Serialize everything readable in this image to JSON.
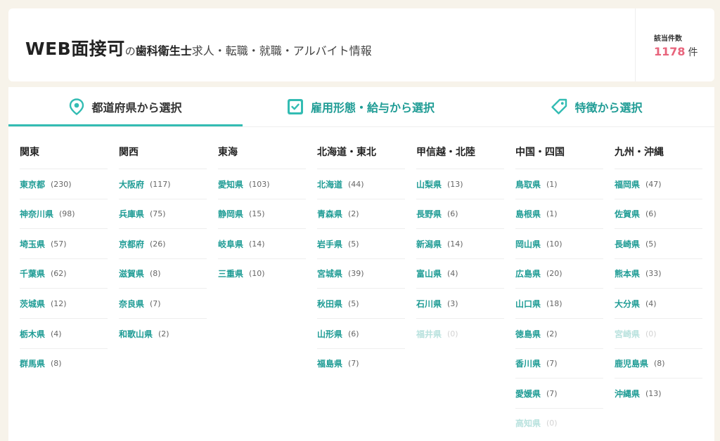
{
  "header": {
    "title_main": "WEB面接可",
    "title_no": "の",
    "title_job": "歯科衛生士",
    "title_rest": "求人・転職・就職・アルバイト情報",
    "count_label": "該当件数",
    "count_value": "1178",
    "count_unit": "件"
  },
  "tabs": [
    {
      "label": "都道府県から選択",
      "icon": "map-pin-icon",
      "active": true
    },
    {
      "label": "雇用形態・給与から選択",
      "icon": "checkbox-icon",
      "active": false
    },
    {
      "label": "特徴から選択",
      "icon": "tag-icon",
      "active": false
    }
  ],
  "colors": {
    "accent": "#33bcb3",
    "link": "#1f9c95",
    "count": "#e8647c",
    "background": "#f7f3ea"
  },
  "regions": [
    {
      "name": "関東",
      "prefs": [
        {
          "name": "東京都",
          "count": "(230)"
        },
        {
          "name": "神奈川県",
          "count": "(98)"
        },
        {
          "name": "埼玉県",
          "count": "(57)"
        },
        {
          "name": "千葉県",
          "count": "(62)"
        },
        {
          "name": "茨城県",
          "count": "(12)"
        },
        {
          "name": "栃木県",
          "count": "(4)"
        },
        {
          "name": "群馬県",
          "count": "(8)"
        }
      ]
    },
    {
      "name": "関西",
      "prefs": [
        {
          "name": "大阪府",
          "count": "(117)"
        },
        {
          "name": "兵庫県",
          "count": "(75)"
        },
        {
          "name": "京都府",
          "count": "(26)"
        },
        {
          "name": "滋賀県",
          "count": "(8)"
        },
        {
          "name": "奈良県",
          "count": "(7)"
        },
        {
          "name": "和歌山県",
          "count": "(2)"
        }
      ]
    },
    {
      "name": "東海",
      "prefs": [
        {
          "name": "愛知県",
          "count": "(103)"
        },
        {
          "name": "静岡県",
          "count": "(15)"
        },
        {
          "name": "岐阜県",
          "count": "(14)"
        },
        {
          "name": "三重県",
          "count": "(10)"
        }
      ]
    },
    {
      "name": "北海道・東北",
      "prefs": [
        {
          "name": "北海道",
          "count": "(44)"
        },
        {
          "name": "青森県",
          "count": "(2)"
        },
        {
          "name": "岩手県",
          "count": "(5)"
        },
        {
          "name": "宮城県",
          "count": "(39)"
        },
        {
          "name": "秋田県",
          "count": "(5)"
        },
        {
          "name": "山形県",
          "count": "(6)"
        },
        {
          "name": "福島県",
          "count": "(7)"
        }
      ]
    },
    {
      "name": "甲信越・北陸",
      "prefs": [
        {
          "name": "山梨県",
          "count": "(13)"
        },
        {
          "name": "長野県",
          "count": "(6)"
        },
        {
          "name": "新潟県",
          "count": "(14)"
        },
        {
          "name": "富山県",
          "count": "(4)"
        },
        {
          "name": "石川県",
          "count": "(3)"
        },
        {
          "name": "福井県",
          "count": "(0)",
          "disabled": true
        }
      ]
    },
    {
      "name": "中国・四国",
      "prefs": [
        {
          "name": "鳥取県",
          "count": "(1)"
        },
        {
          "name": "島根県",
          "count": "(1)"
        },
        {
          "name": "岡山県",
          "count": "(10)"
        },
        {
          "name": "広島県",
          "count": "(20)"
        },
        {
          "name": "山口県",
          "count": "(18)"
        },
        {
          "name": "徳島県",
          "count": "(2)"
        },
        {
          "name": "香川県",
          "count": "(7)"
        },
        {
          "name": "愛媛県",
          "count": "(7)"
        },
        {
          "name": "高知県",
          "count": "(0)",
          "disabled": true
        }
      ]
    },
    {
      "name": "九州・沖縄",
      "prefs": [
        {
          "name": "福岡県",
          "count": "(47)"
        },
        {
          "name": "佐賀県",
          "count": "(6)"
        },
        {
          "name": "長崎県",
          "count": "(5)"
        },
        {
          "name": "熊本県",
          "count": "(33)"
        },
        {
          "name": "大分県",
          "count": "(4)"
        },
        {
          "name": "宮崎県",
          "count": "(0)",
          "disabled": true
        },
        {
          "name": "鹿児島県",
          "count": "(8)"
        },
        {
          "name": "沖縄県",
          "count": "(13)"
        }
      ]
    }
  ]
}
